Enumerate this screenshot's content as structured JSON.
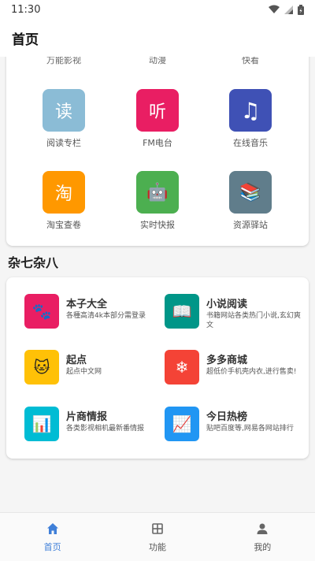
{
  "status_bar": {
    "time": "11:30"
  },
  "app_bar": {
    "title": "首页"
  },
  "top_card": {
    "clipped_labels": [
      "万能影视",
      "动漫",
      "快看"
    ],
    "items": [
      {
        "label": "阅读专栏",
        "glyph": "读",
        "color": "#8bbcd6",
        "icon": "read-icon"
      },
      {
        "label": "FM电台",
        "glyph": "听",
        "color": "#e91e63",
        "icon": "listen-icon"
      },
      {
        "label": "在线音乐",
        "glyph": "♫",
        "color": "#3f51b5",
        "icon": "music-note-icon"
      },
      {
        "label": "淘宝查卷",
        "glyph": "淘",
        "color": "#ff9800",
        "icon": "taobao-icon"
      },
      {
        "label": "实时快报",
        "glyph": "🤖",
        "color": "#4caf50",
        "icon": "robot-icon"
      },
      {
        "label": "资源驿站",
        "glyph": "📚",
        "color": "#607d8b",
        "icon": "books-icon"
      }
    ]
  },
  "misc_section": {
    "title": "杂七杂八",
    "items": [
      {
        "title": "本子大全",
        "desc": "各種高清4k本部分需登录",
        "glyph": "🐾",
        "color": "#e91e63",
        "icon": "paw-icon"
      },
      {
        "title": "小说阅读",
        "desc": "书籍网站各类热门小说,玄幻爽文",
        "glyph": "📖",
        "color": "#009688",
        "icon": "open-book-icon"
      },
      {
        "title": "起点",
        "desc": "起点中文网",
        "glyph": "🐱",
        "color": "#ffc107",
        "icon": "cat-icon"
      },
      {
        "title": "多多商城",
        "desc": "超低价手机壳内衣,进行售卖!",
        "glyph": "❄",
        "color": "#f44336",
        "icon": "snowflake-icon"
      },
      {
        "title": "片商情报",
        "desc": "各类影视相机最新番情报",
        "glyph": "📊",
        "color": "#00bcd4",
        "icon": "bar-chart-icon"
      },
      {
        "title": "今日热榜",
        "desc": "贴吧百度等,网易各网站排行",
        "glyph": "📈",
        "color": "#2196f3",
        "icon": "trending-chart-icon"
      }
    ]
  },
  "bottom_nav": {
    "items": [
      {
        "label": "首页",
        "icon": "home-icon",
        "active": true
      },
      {
        "label": "功能",
        "icon": "grid-icon",
        "active": false
      },
      {
        "label": "我的",
        "icon": "person-icon",
        "active": false
      }
    ]
  },
  "colors": {
    "accent": "#3f7fd8"
  }
}
